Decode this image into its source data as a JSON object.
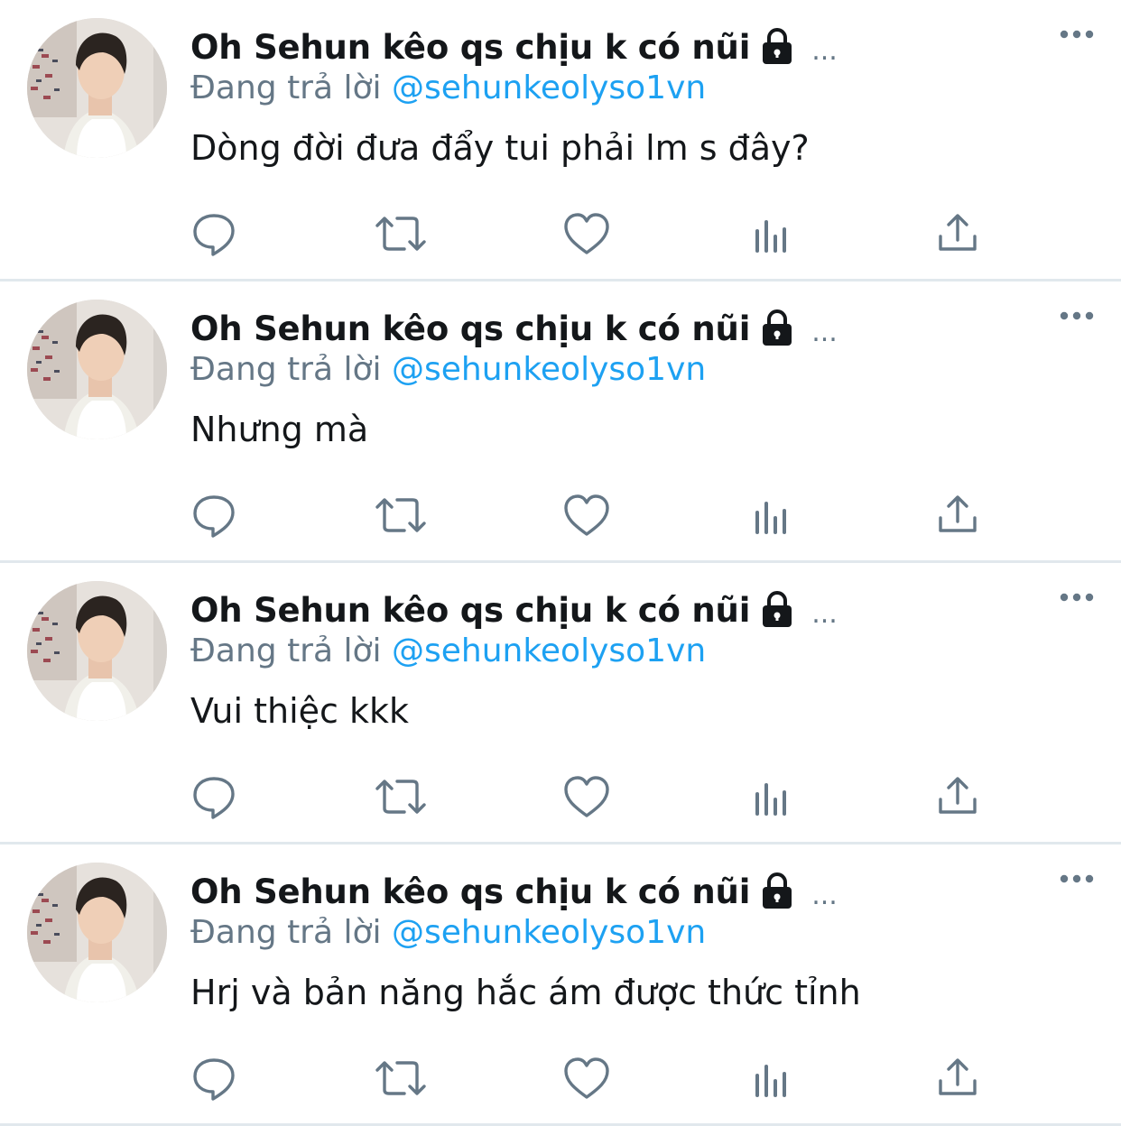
{
  "colors": {
    "text_primary": "#14171a",
    "text_secondary": "#657786",
    "link": "#1da1f2",
    "divider": "#e1e8ed",
    "icon": "#657786"
  },
  "tweets": [
    {
      "display_name": "Oh Sehun kêo qs chịu k có nũi",
      "truncation": "...",
      "reply_prefix": "Đang trả lời",
      "reply_handle": "@sehunkeolyso1vn",
      "text": "Dòng đời đưa đẩy tui phải lm s đây?"
    },
    {
      "display_name": "Oh Sehun kêo qs chịu k có nũi",
      "truncation": "...",
      "reply_prefix": "Đang trả lời",
      "reply_handle": "@sehunkeolyso1vn",
      "text": "Nhưng mà"
    },
    {
      "display_name": "Oh Sehun kêo qs chịu k có nũi",
      "truncation": "...",
      "reply_prefix": "Đang trả lời",
      "reply_handle": "@sehunkeolyso1vn",
      "text": "Vui thiệc kkk"
    },
    {
      "display_name": "Oh Sehun kêo qs chịu k có nũi",
      "truncation": "...",
      "reply_prefix": "Đang trả lời",
      "reply_handle": "@sehunkeolyso1vn",
      "text": "Hrj và bản năng hắc ám được thức tỉnh"
    }
  ],
  "icons": {
    "lock": "lock-icon",
    "more": "more-icon",
    "reply": "reply-icon",
    "retweet": "retweet-icon",
    "like": "like-icon",
    "analytics": "analytics-icon",
    "share": "share-icon"
  }
}
